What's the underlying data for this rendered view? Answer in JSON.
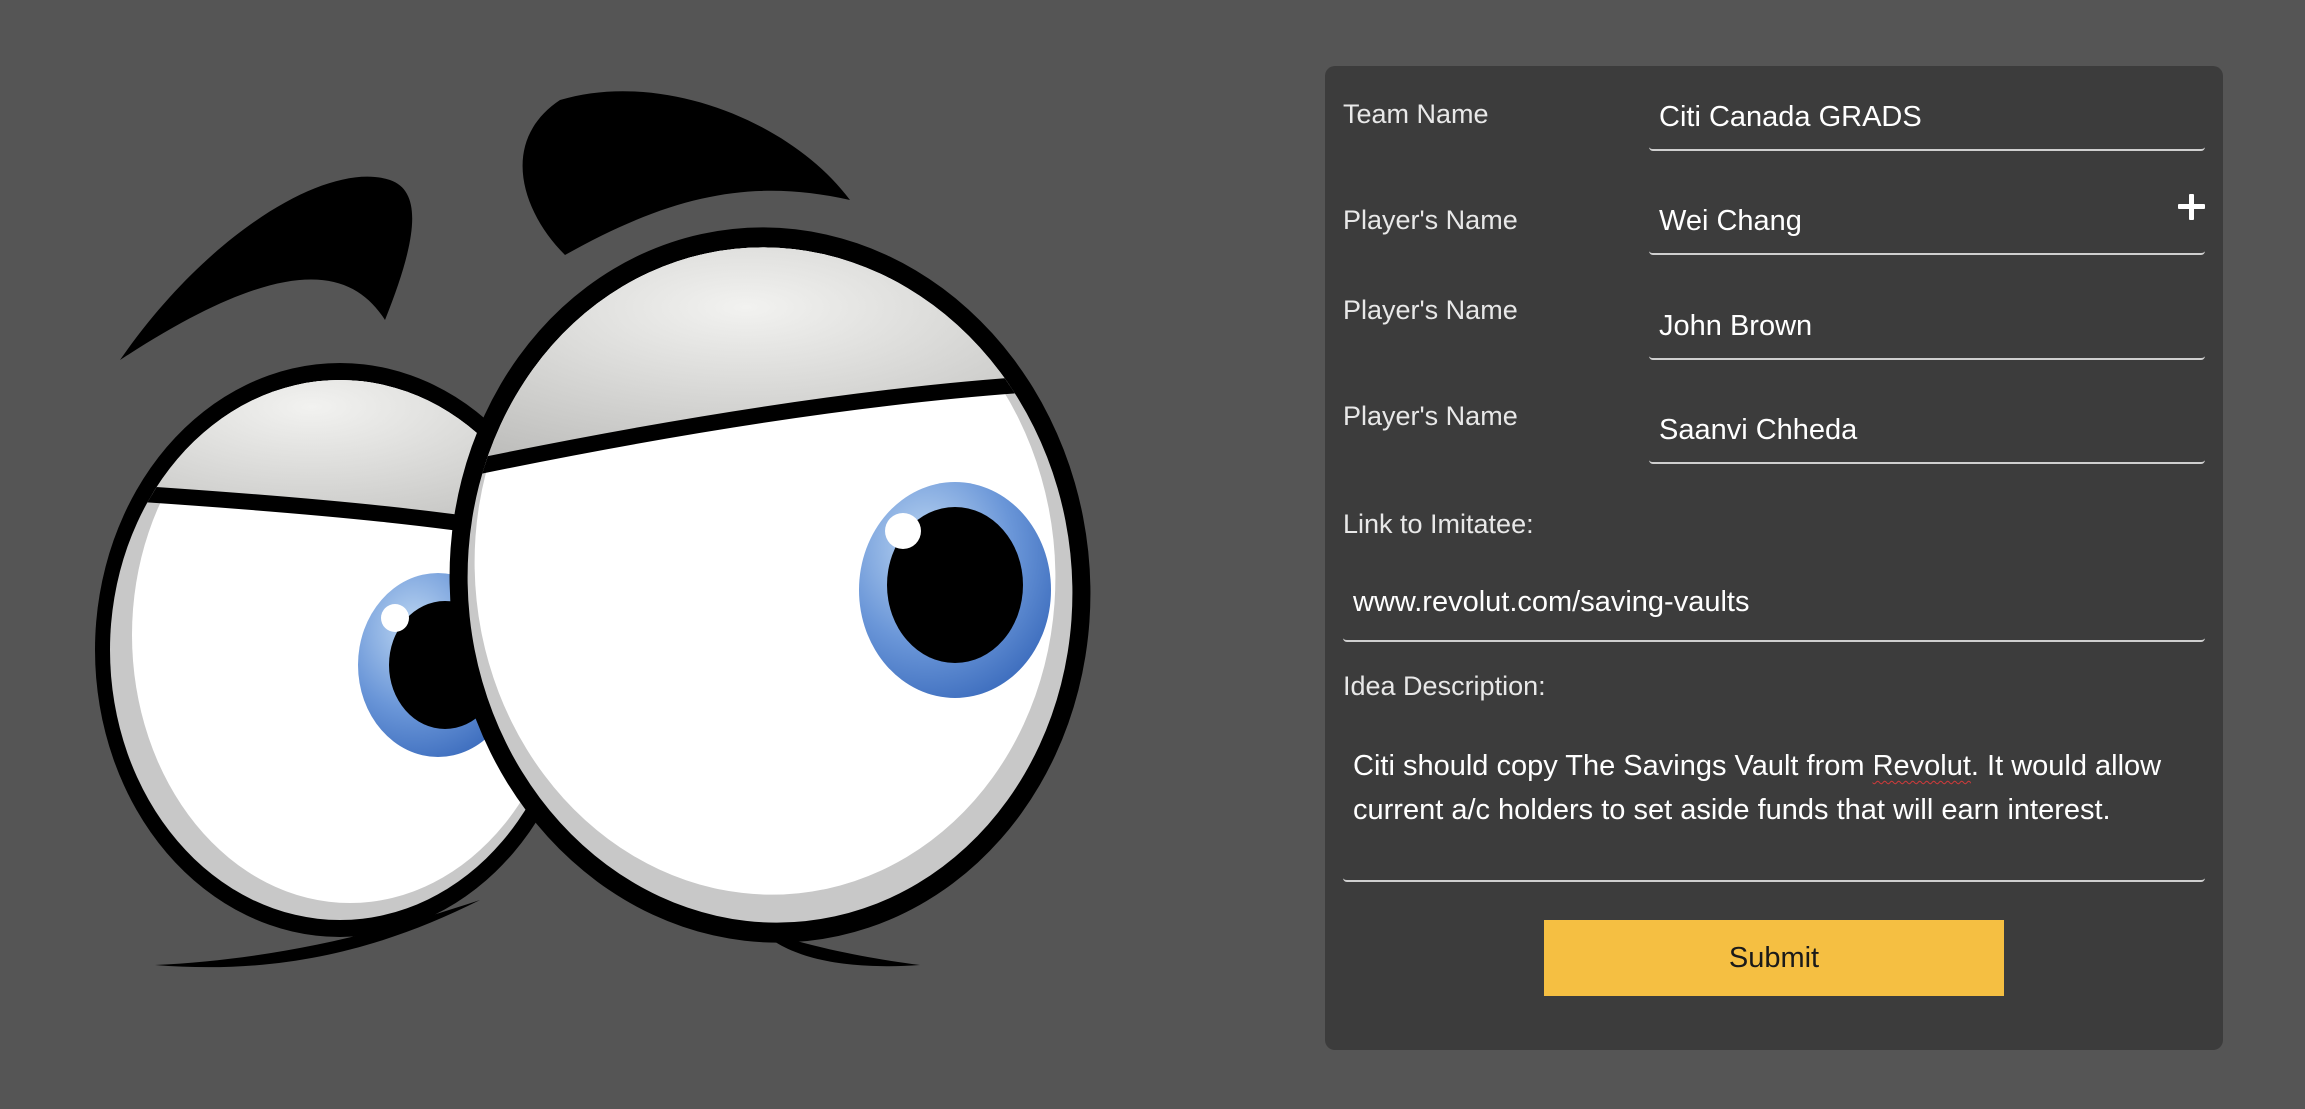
{
  "form": {
    "team": {
      "label": "Team Name",
      "value": "Citi Canada GRADS"
    },
    "players": [
      {
        "label": "Player's Name",
        "value": "Wei Chang"
      },
      {
        "label": "Player's Name",
        "value": "John Brown"
      },
      {
        "label": "Player's Name",
        "value": "Saanvi Chheda"
      }
    ],
    "add_player_icon": "plus-icon",
    "link": {
      "label": "Link to Imitatee:",
      "value": "www.revolut.com/saving-vaults"
    },
    "idea": {
      "label": "Idea Description:",
      "value_before": "Citi should copy The Savings Vault from ",
      "value_flagged_word": "Revolut",
      "value_after": ". It would allow current a/c holders to set aside funds that will earn interest."
    },
    "submit_label": "Submit"
  },
  "illustration": {
    "subject": "cartoon-eyes",
    "iris_color": "#4a78c8",
    "brow_color": "#000000"
  },
  "colors": {
    "page_background": "#555555",
    "panel_background": "#3c3c3c",
    "accent": "#f5bf42",
    "text": "#ffffff"
  }
}
